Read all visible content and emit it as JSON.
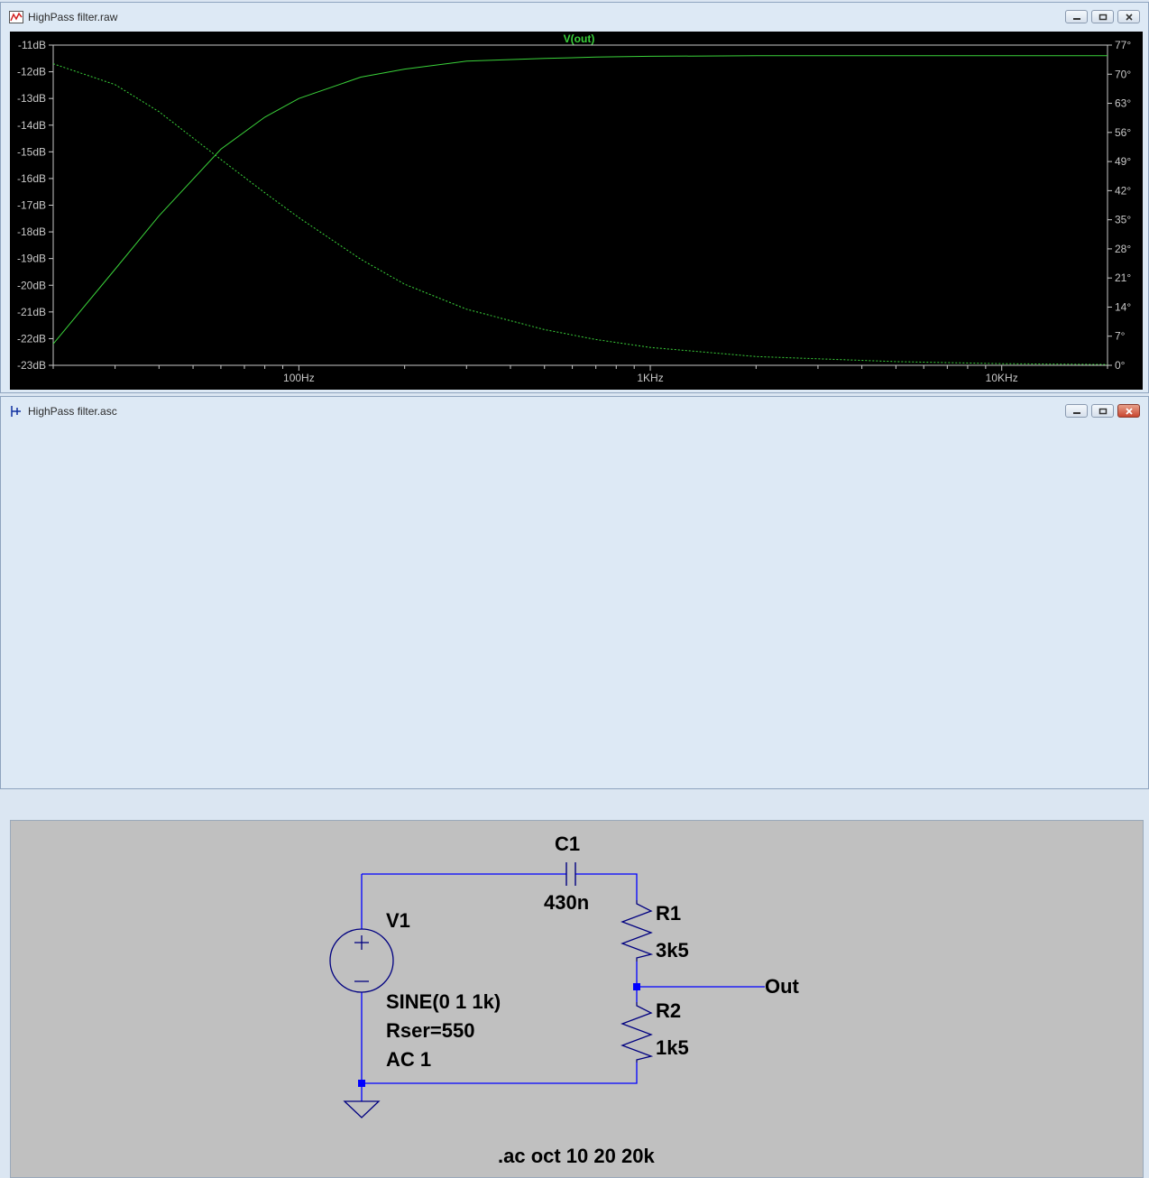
{
  "raw_window": {
    "title": "HighPass filter.raw",
    "trace_label": "V(out)",
    "colors": {
      "trace": "#3ad23a",
      "grid_text": "#c8c8c8",
      "background": "#000000"
    }
  },
  "asc_window": {
    "title": "HighPass filter.asc",
    "components": {
      "c1_name": "C1",
      "c1_value": "430n",
      "v1_name": "V1",
      "v1_line1": "SINE(0 1 1k)",
      "v1_line2": "Rser=550",
      "v1_line3": "AC 1",
      "r1_name": "R1",
      "r1_value": "3k5",
      "r2_name": "R2",
      "r2_value": "1k5",
      "net_out": "Out"
    },
    "directive": ".ac oct 10 20 20k",
    "colors": {
      "wire": "#0000ff",
      "component": "#000080",
      "background": "#c0c0c0"
    }
  },
  "window_controls": [
    "minimize",
    "maximize",
    "close"
  ],
  "chart_data": {
    "type": "line",
    "title": "V(out)",
    "x_scale": "log",
    "x_ticks": [
      "100Hz",
      "1KHz",
      "10KHz"
    ],
    "xlim": [
      20,
      20000
    ],
    "y_left_ticks": [
      "-11dB",
      "-12dB",
      "-13dB",
      "-14dB",
      "-15dB",
      "-16dB",
      "-17dB",
      "-18dB",
      "-19dB",
      "-20dB",
      "-21dB",
      "-22dB",
      "-23dB"
    ],
    "ylim_left": [
      -23,
      -11
    ],
    "y_right_ticks": [
      "77°",
      "70°",
      "63°",
      "56°",
      "49°",
      "42°",
      "35°",
      "28°",
      "21°",
      "14°",
      "7°",
      "0°"
    ],
    "ylim_right": [
      0,
      77
    ],
    "grid": false,
    "series": [
      {
        "axis": "left",
        "style": "solid",
        "x": [
          20,
          30,
          40,
          60,
          80,
          100,
          150,
          200,
          300,
          500,
          700,
          1000,
          2000,
          5000,
          10000,
          20000
        ],
        "y": [
          -22.2,
          -19.4,
          -17.4,
          -14.9,
          -13.7,
          -13.0,
          -12.2,
          -11.9,
          -11.6,
          -11.5,
          -11.45,
          -11.42,
          -11.4,
          -11.4,
          -11.4,
          -11.4
        ]
      },
      {
        "axis": "right",
        "style": "dashed",
        "x": [
          20,
          30,
          40,
          60,
          80,
          100,
          150,
          200,
          300,
          500,
          700,
          1000,
          2000,
          5000,
          10000,
          20000
        ],
        "y": [
          72.5,
          67.5,
          61,
          49.5,
          41.5,
          35.5,
          25.5,
          19.5,
          13.5,
          8.6,
          6.2,
          4.3,
          2.1,
          0.9,
          0.4,
          0.2
        ]
      }
    ]
  }
}
